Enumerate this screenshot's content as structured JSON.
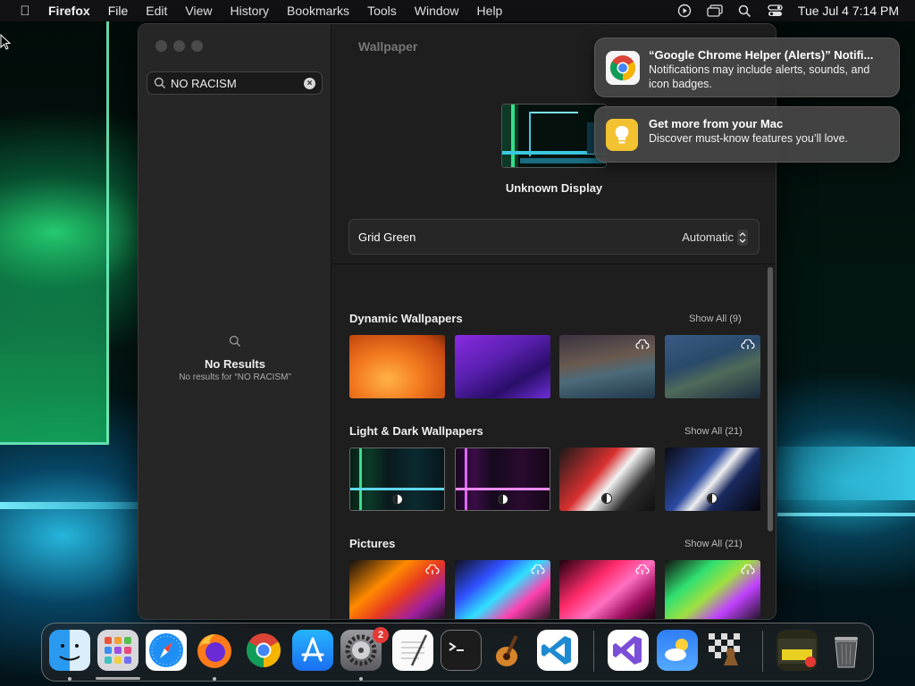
{
  "menubar": {
    "app_name": "Firefox",
    "menus": [
      "File",
      "Edit",
      "View",
      "History",
      "Bookmarks",
      "Tools",
      "Window",
      "Help"
    ],
    "datetime": "Tue Jul 4  7:14 PM",
    "status_icons": [
      "play-circle-icon",
      "screen-mirroring-icon",
      "spotlight-search-icon",
      "control-center-icon"
    ]
  },
  "settings": {
    "search": {
      "value": "NO RACISM",
      "placeholder": "Search"
    },
    "no_results": {
      "title": "No Results",
      "subtitle": "No results for “NO RACISM”"
    },
    "title": "Wallpaper",
    "display_label": "Unknown Display",
    "current_wallpaper": {
      "name": "Grid Green",
      "mode": "Automatic"
    },
    "sections": [
      {
        "title": "Dynamic Wallpapers",
        "show_all": "Show All (9)"
      },
      {
        "title": "Light & Dark Wallpapers",
        "show_all": "Show All (21)"
      },
      {
        "title": "Pictures",
        "show_all": "Show All (21)"
      }
    ]
  },
  "notifications": [
    {
      "title": "“Google Chrome Helper (Alerts)” Notifi...",
      "body": "Notifications may include alerts, sounds, and icon badges.",
      "icon": "chrome-icon"
    },
    {
      "title": "Get more from your Mac",
      "body": "Discover must-know features you’ll love.",
      "icon": "tips-icon"
    }
  ],
  "dock": {
    "items": [
      "Finder",
      "Launchpad",
      "Safari",
      "Firefox",
      "Google Chrome",
      "App Store",
      "System Settings",
      "TextEdit",
      "Terminal",
      "GarageBand",
      "Visual Studio Code",
      "Visual Studio",
      "Weather",
      "Chess",
      "Downloads",
      "Trash"
    ],
    "settings_badge": "2"
  },
  "colors": {
    "accent": "#0a84ff",
    "badge": "#e53935",
    "window_bg": "#1e1e1e",
    "sidebar_bg": "#262626"
  }
}
